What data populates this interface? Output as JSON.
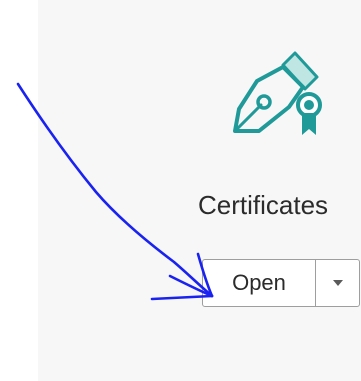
{
  "tool": {
    "label": "Certificates",
    "icon": "certificate-pen-icon",
    "accent_color": "#1f9a99",
    "accent_light_color": "#bfe6e2"
  },
  "actions": {
    "open_label": "Open",
    "dropdown_icon": "chevron-down-icon"
  },
  "annotation": {
    "type": "hand-drawn arrow",
    "color": "#1a22f0"
  }
}
